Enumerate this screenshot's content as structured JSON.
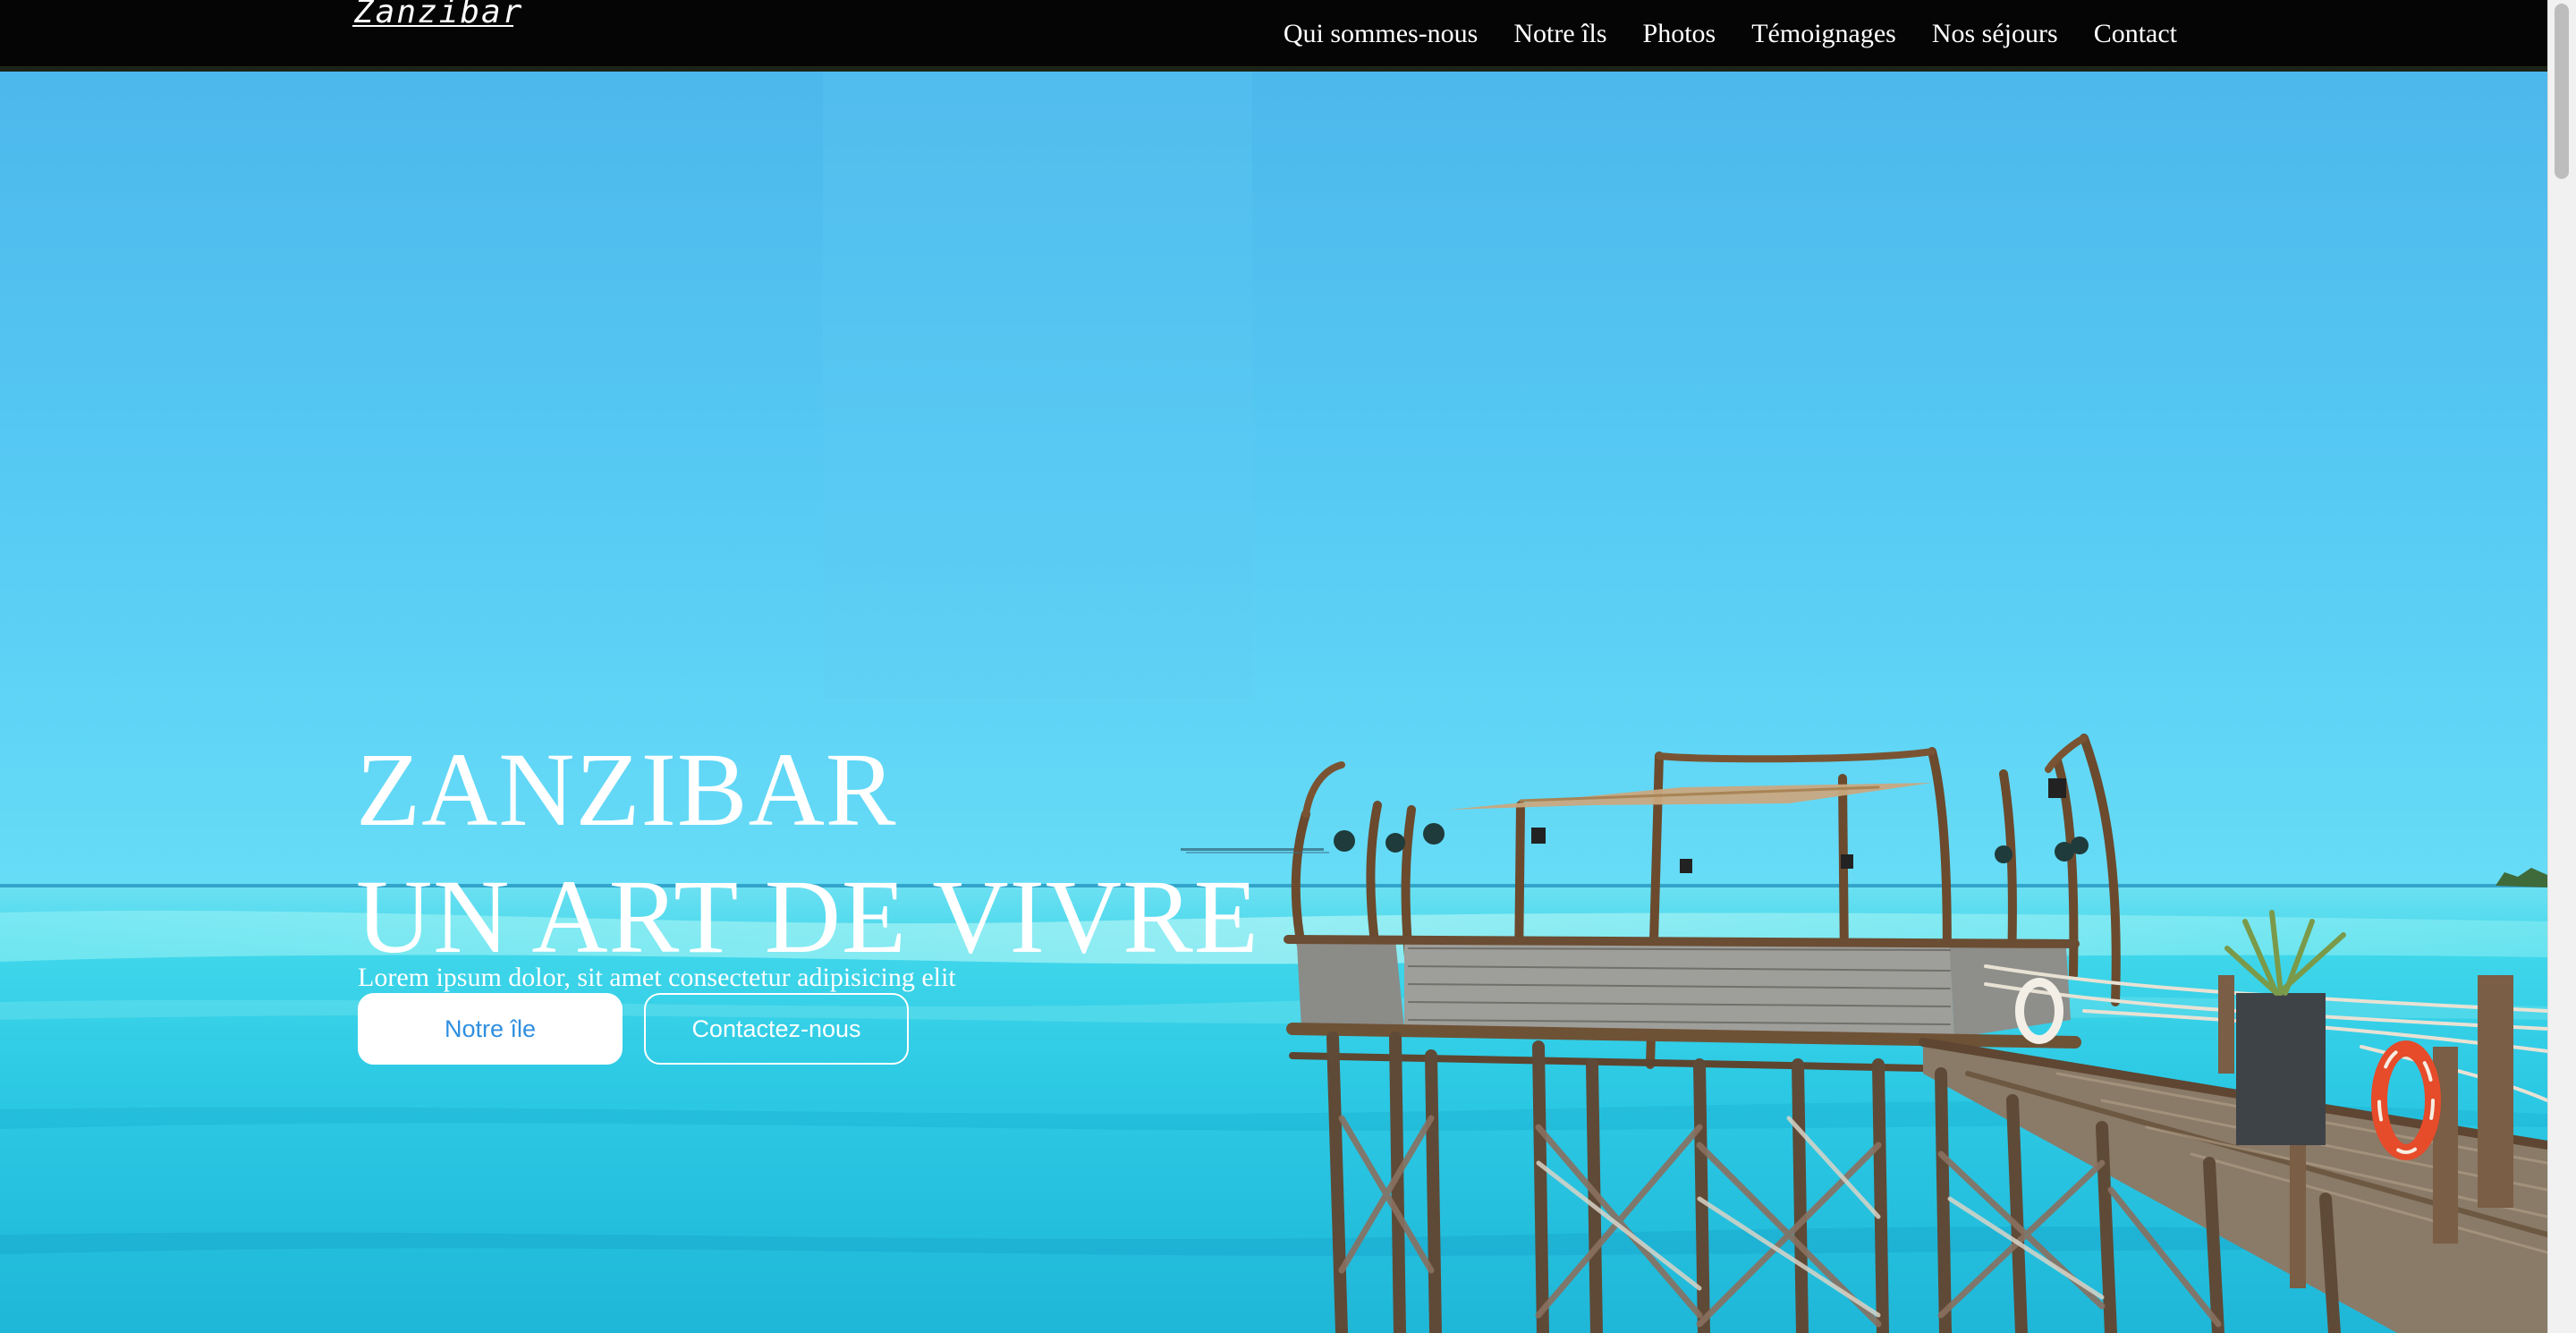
{
  "header": {
    "logo": "Zanzibar",
    "nav": [
      {
        "label": "Qui sommes-nous"
      },
      {
        "label": "Notre îls"
      },
      {
        "label": "Photos"
      },
      {
        "label": "Témoignages"
      },
      {
        "label": "Nos séjours"
      },
      {
        "label": "Contact"
      }
    ]
  },
  "hero": {
    "title_line1": "ZANZIBAR",
    "title_line2": "UN ART DE VIVRE",
    "subtitle": "Lorem ipsum dolor, sit amet consectetur adipisicing elit",
    "primary_button": "Notre île",
    "secondary_button": "Contactez-nous",
    "background": "tropical-sea-pier-photo"
  },
  "colors": {
    "navbar": "#050505",
    "sky": "#4fb8ec",
    "sea": "#2ad0e6",
    "button_text": "#2f8fe0",
    "text": "#ffffff"
  }
}
